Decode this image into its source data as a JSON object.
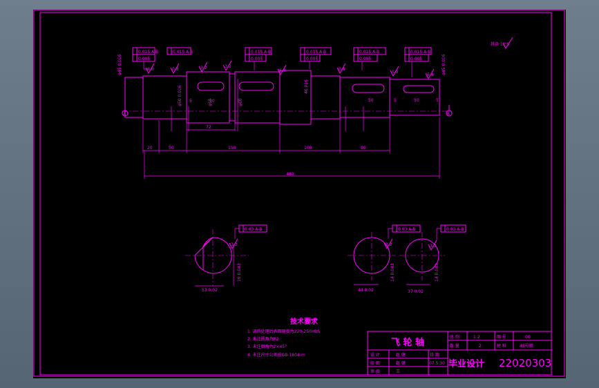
{
  "shaft": {
    "dims": {
      "d1": "20",
      "d2": "50",
      "d3": "150",
      "d4": "100",
      "d5": "80",
      "total": "480",
      "k72": "72",
      "k50a": "50",
      "k50b": "50",
      "k50c": "50",
      "k5a": "5",
      "k5b": "5",
      "k5c": "5",
      "k5d": "5"
    },
    "diam_labels": [
      "φ45 0.016",
      "φ50 0.016",
      "φ55",
      "φ60",
      "40.016",
      "φ45 0.016"
    ],
    "fcf": [
      [
        "0.015 A-B",
        "0.005"
      ],
      [
        "0.015 A-B",
        "0.005"
      ],
      [
        "0.015 A-B",
        "0.005"
      ],
      [
        "0.015 A-B",
        "0.005"
      ],
      [
        "0.015 A-B",
        "0.005"
      ]
    ],
    "rough": [
      "0.8",
      "0.8",
      "3.2",
      "3.2",
      "6.3",
      "6.3",
      "0.8",
      "0.8",
      "6.3",
      "6.4"
    ],
    "datum_a": "A",
    "datum_b": "B",
    "corner_mark": "其余 12.5"
  },
  "sections": {
    "fcf": [
      "0.03 A-B",
      "0.03 A-B",
      "0.03 A-B"
    ],
    "rough": [
      "3.2",
      "3.2",
      "3.2"
    ],
    "depth": [
      "53 0.02",
      "44 0.02",
      "37 0.02"
    ],
    "width": [
      "16 0.043",
      "14 0.043",
      "14 0.043"
    ]
  },
  "tech": {
    "title": "技术要求",
    "items": [
      "1. 调质处理后表面硬度为220-250HBS",
      "2. 未注圆角为R2",
      "3. 未注倒角为2×45°",
      "4. 未注尺寸公差按GB-1804-m"
    ]
  },
  "title_block": {
    "part_name": "飞 轮 轴",
    "scale_label": "比 例",
    "scale_value": "1:2",
    "drawing_no_label": "图 号",
    "drawing_no_value": "00",
    "qty_label": "数 量",
    "qty_value": "2",
    "material_label": "材 料",
    "material_value": "45号钢",
    "design_label": "设 计",
    "design_name": "赵 健",
    "draw_label": "绘 图",
    "draw_name": "赵 健",
    "review_label": "审 阅",
    "review_name": "王",
    "date_label": "日 期",
    "date_value": "07.5.30",
    "project": "毕业设计",
    "code": "22020303"
  }
}
